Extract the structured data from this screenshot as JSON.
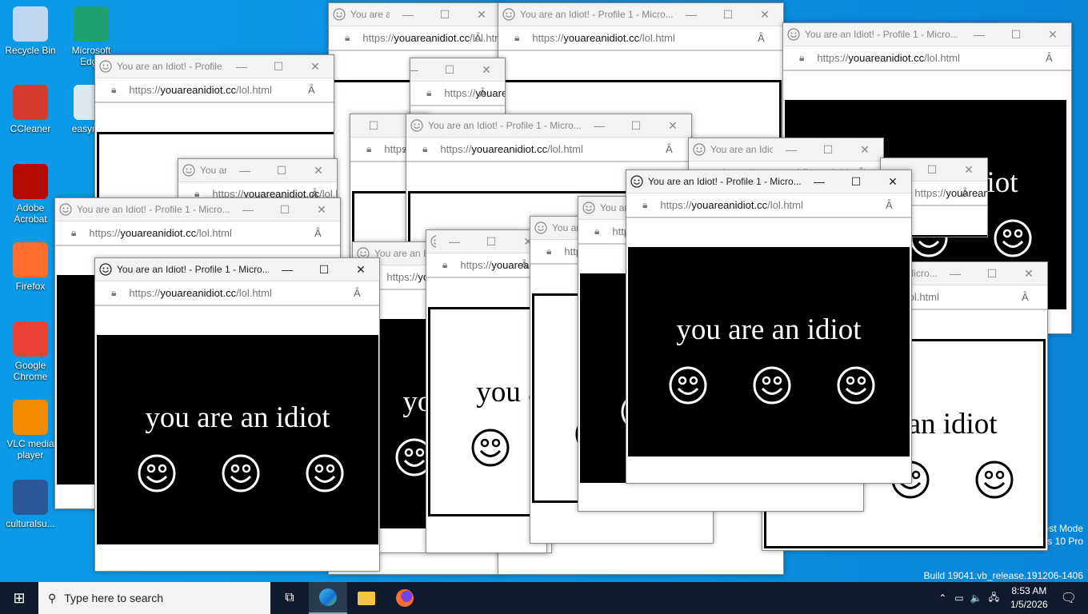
{
  "desktop": {
    "icons": [
      {
        "label": "Recycle Bin",
        "color": "#bcd7ef"
      },
      {
        "label": "Microsoft Edge",
        "color": "#1d9f6e"
      },
      {
        "label": "CCleaner",
        "color": "#d73a2f"
      },
      {
        "label": "easyne...",
        "color": "#dfe8f0"
      },
      {
        "label": "Adobe Acrobat",
        "color": "#b30b00"
      },
      {
        "label": "Firefox",
        "color": "#ff6d2c"
      },
      {
        "label": "Google Chrome",
        "color": "#e84335"
      },
      {
        "label": "VLC media player",
        "color": "#f28a00"
      },
      {
        "label": "culturalsu...",
        "color": "#2b579a"
      }
    ]
  },
  "watermark": {
    "line1": "Test Mode",
    "line2": "Windows 10 Pro",
    "line3": "Build 19041.vb_release.191206-1406"
  },
  "browser": {
    "title": "You are an Idiot! - Profile 1 - Micro...",
    "url_scheme": "https://",
    "url_host": "youareanidiot.cc",
    "url_path": "/lol.html",
    "minimize": "—",
    "maximize": "☐",
    "close": "✕",
    "read_aloud": "Ȃ",
    "lock": "🔒"
  },
  "page": {
    "text": "you are an idiot",
    "smiley_count": 3
  },
  "taskbar": {
    "search_placeholder": "Type here to search",
    "time": "8:53 AM",
    "date": "1/5/2026"
  }
}
